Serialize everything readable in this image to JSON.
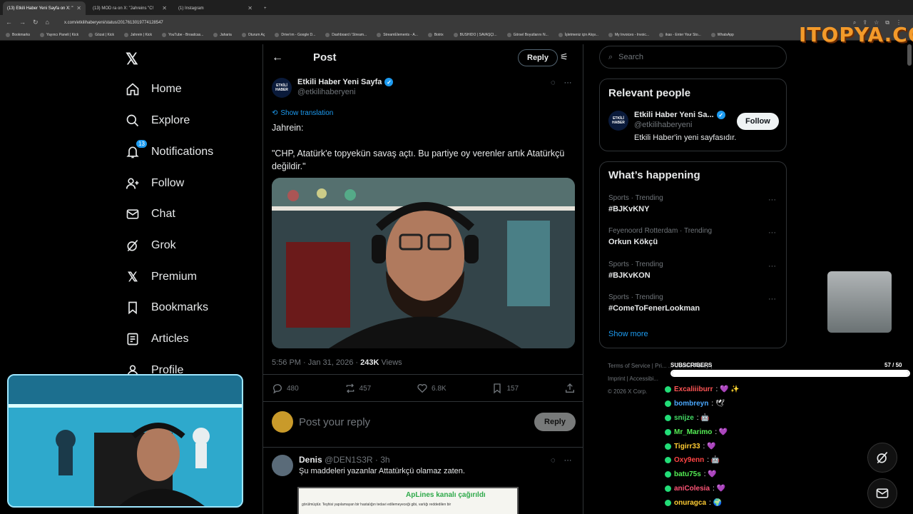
{
  "browser": {
    "tabs": [
      {
        "title": "(13) Etkili Haber Yeni Sayfa on X: \"",
        "active": true
      },
      {
        "title": "(13) MOD ra on X: \"Jahreins \"C!",
        "active": false
      },
      {
        "title": "(1) Instagram",
        "active": false
      }
    ],
    "url": "x.com/etkilihaberyeni/status/2017613019774128547",
    "bookmarks": [
      "Bookmarks",
      "Yayıncı Paneli | Kick",
      "Gözat | Kick",
      "Jahrein | Kick",
      "YouTube - Broadcas...",
      "Jaharia",
      "Oturum Aç",
      "Drive'ım - Google D...",
      "Dashboard / Stream...",
      "StreamElements - A...",
      "Botrix",
      "BUSHIDO | SAVAŞÇI...",
      "Görsel Boyutlarını N...",
      "İşletmeniz için Alışv...",
      "My Invoices - Invoic...",
      "ikas - Enter Your Sto...",
      "WhatsApp"
    ]
  },
  "nav": {
    "items": [
      "Home",
      "Explore",
      "Notifications",
      "Follow",
      "Chat",
      "Grok",
      "Premium",
      "Bookmarks",
      "Articles",
      "Profile"
    ],
    "notifications_count": "13"
  },
  "header": {
    "title": "Post",
    "reply_label": "Reply"
  },
  "post": {
    "author_name": "Etkili Haber Yeni Sayfa",
    "author_handle": "@etkilihaberyeni",
    "avatar_text": "ETKİLİ HABER",
    "show_translation": "Show translation",
    "text": "Jahrein:\n\n\"CHP, Atatürk'e topyekün savaş açtı. Bu partiye oy verenler artık Atatürkçü değildir.\"",
    "time": "5:56 PM · Jan 31, 2026 · ",
    "views_count": "243K",
    "views_label": " Views",
    "replies": "480",
    "reposts": "457",
    "likes": "6.8K",
    "bookmarks": "157"
  },
  "reply_box": {
    "placeholder": "Post your reply",
    "button": "Reply"
  },
  "comment": {
    "name": "Denis",
    "meta": "@DEN1S3R · 3h",
    "text": "Şu maddeleri yazanlar Attatürkçü olamaz zaten.",
    "image_headline": "ApLines kanalı çağırıldı",
    "image_text": "görülmüştür. Teşhisi yapılamayan bir hastalığın tedavi edilemeyeceği gibi, varlığı reddedilen bir"
  },
  "search": {
    "placeholder": "Search"
  },
  "relevant_people": {
    "title": "Relevant people",
    "name": "Etkili Haber Yeni Sa...",
    "handle": "@etkilihaberyeni",
    "bio": "Etkili Haber'in yeni sayfasıdır.",
    "follow": "Follow"
  },
  "happening": {
    "title": "What’s happening",
    "trends": [
      {
        "meta": "Sports · Trending",
        "name": "#BJKvKNY"
      },
      {
        "meta": "Feyenoord Rotterdam · Trending",
        "name": "Orkun Kökçü"
      },
      {
        "meta": "Sports · Trending",
        "name": "#BJKvKON"
      },
      {
        "meta": "Sports · Trending",
        "name": "#ComeToFenerLookman"
      }
    ],
    "show_more": "Show more"
  },
  "footer": {
    "line1": "Terms of Service  |  Pri...   ...  Cookie Policy  |",
    "line2": "Imprint  |  Accessibi...",
    "line3": "© 2026 X Corp."
  },
  "overlay": {
    "logo": "ITOPYA.COM",
    "subs_label": "SUBSCRIBERS",
    "subs_count": "57 / 50",
    "subs_progress": 1.0,
    "chat": [
      {
        "user": "Excaliiiburr",
        "color": "#ff5555",
        "msg": ": 💜 ✨"
      },
      {
        "user": "bombreyn",
        "color": "#4aa8ff",
        "msg": ": 🕊"
      },
      {
        "user": "snijze",
        "color": "#44dd66",
        "msg": ": 🤖"
      },
      {
        "user": "Mr_Marimo",
        "color": "#55ee55",
        "msg": ": 💜"
      },
      {
        "user": "Tigirr33",
        "color": "#ffcc33",
        "msg": ": 💜"
      },
      {
        "user": "Oxy9enn",
        "color": "#ff4444",
        "msg": ": 🤖"
      },
      {
        "user": "batu75s",
        "color": "#55ee55",
        "msg": ": 💜"
      },
      {
        "user": "aniColesia",
        "color": "#ff5577",
        "msg": ": 💜"
      },
      {
        "user": "onuragca",
        "color": "#ffcc33",
        "msg": ": 🌍"
      }
    ]
  },
  "colors": {
    "accent": "#1d9bf0",
    "background": "#000000",
    "border": "#2f3336",
    "muted": "#71767b"
  }
}
